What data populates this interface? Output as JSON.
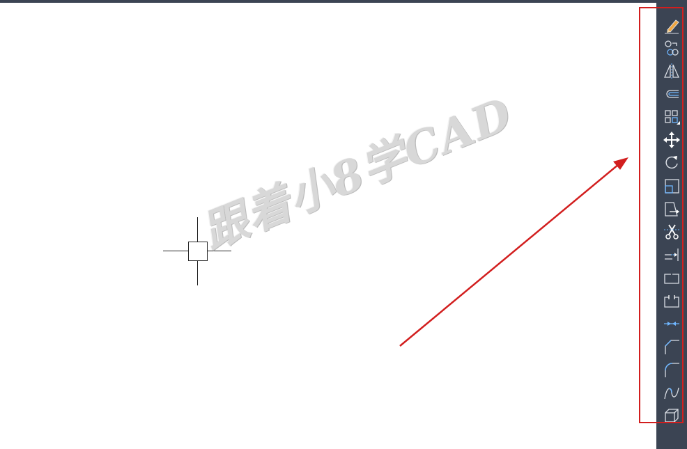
{
  "watermark": {
    "text": "跟着小8学CAD"
  },
  "colors": {
    "toolbar_bg": "#3b4453",
    "icon": "#d9dde4",
    "icon_accent": "#6fb6ff",
    "annotation_red": "#d21e1e"
  },
  "modify_toolbar": {
    "tools": [
      {
        "name": "erase-icon"
      },
      {
        "name": "copy-icon"
      },
      {
        "name": "mirror-icon"
      },
      {
        "name": "offset-icon"
      },
      {
        "name": "array-icon"
      },
      {
        "name": "move-icon"
      },
      {
        "name": "rotate-icon"
      },
      {
        "name": "scale-icon"
      },
      {
        "name": "stretch-icon"
      },
      {
        "name": "trim-icon"
      },
      {
        "name": "extend-icon"
      },
      {
        "name": "break-at-point-icon"
      },
      {
        "name": "break-icon"
      },
      {
        "name": "join-icon"
      },
      {
        "name": "chamfer-icon"
      },
      {
        "name": "fillet-icon"
      },
      {
        "name": "blend-curves-icon"
      },
      {
        "name": "explode-icon"
      }
    ]
  }
}
